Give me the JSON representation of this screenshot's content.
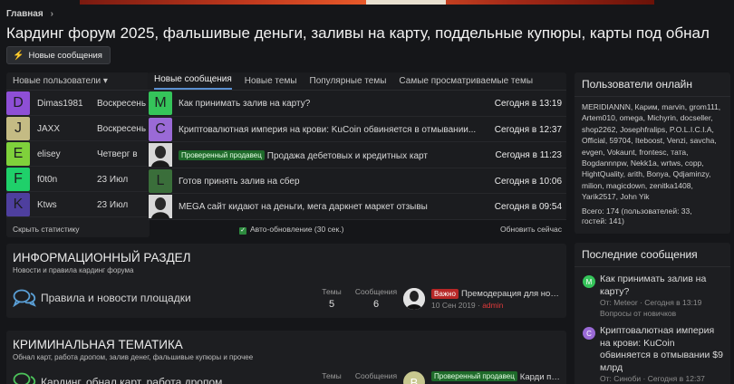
{
  "breadcrumb": {
    "home": "Главная",
    "sep": "›"
  },
  "page_title": "Кардинг форум 2025, фальшивые деньги, заливы на карту, поддельные купюры, карты под обнал",
  "new_posts_button": "Новые сообщения",
  "new_users": {
    "header": "Новые пользователи ▾",
    "rows": [
      {
        "letter": "D",
        "color": "#8e4fd6",
        "name": "Dimas1981",
        "date": "Воскресень"
      },
      {
        "letter": "J",
        "color": "#c4bb84",
        "name": "JAXX",
        "date": "Воскресень"
      },
      {
        "letter": "E",
        "color": "#7fd13b",
        "name": "elisey",
        "date": "Четверг в"
      },
      {
        "letter": "F",
        "color": "#1fd06a",
        "name": "f0t0n",
        "date": "23 Июл"
      },
      {
        "letter": "K",
        "color": "#4e3f9e",
        "name": "Ktws",
        "date": "23 Июл"
      }
    ]
  },
  "tabs": [
    "Новые сообщения",
    "Новые темы",
    "Популярные темы",
    "Самые просматриваемые темы"
  ],
  "messages": [
    {
      "letter": "M",
      "color": "#35c45a",
      "badge": "",
      "title": "Как принимать залив на карту?",
      "time": "Сегодня в 13:19"
    },
    {
      "letter": "C",
      "color": "#9a6ad6",
      "badge": "",
      "title": "Криптовалютная империя на крови: KuCoin обвиняется в отмывании...",
      "time": "Сегодня в 12:37"
    },
    {
      "letter": "",
      "color": "#dcdcdc",
      "badge": "Проверенный продавец",
      "title": "Продажа дебетовых и кредитных карт",
      "time": "Сегодня в 11:23"
    },
    {
      "letter": "L",
      "color": "#3a6e3a",
      "badge": "",
      "title": "Готов принять залив на сбер",
      "time": "Сегодня в 10:06"
    },
    {
      "letter": "",
      "color": "#cfcfcf",
      "badge": "",
      "title": "MEGA сайт кидают на деньги, мега даркнет маркет отзывы",
      "time": "Сегодня в 09:54"
    }
  ],
  "stats_bar": {
    "left": "Скрыть статистику",
    "middle": "Авто-обновление (30 сек.)",
    "right": "Обновить сейчас"
  },
  "online": {
    "title": "Пользователи онлайн",
    "list": "MERIDIANNN, Карим, marvin, grom111, Artem010, omega, Michyrin, docseller, shop2262, Josephfralips, P.O.L.I.C.I.A, Official, 59704, Iteboost, Venzi, savcha, evgen, Vokaunt, frontesc, тата, Bogdannnpw, Nekk1a, wrtws, copp, HightQuality, arith, Bonya, Qdjaminzy, milion, magicdown, zenitka1408, Yarik2517, John Yik",
    "total_line1": "Всего: 174 (пользователей: 33,",
    "total_line2": "гостей: 141)"
  },
  "recent": {
    "title": "Последние сообщения",
    "items": [
      {
        "letter": "M",
        "color": "#35c45a",
        "title": "Как принимать залив на карту?",
        "meta1": "От: Meteor · Сегодня в 13:19",
        "meta2": "Вопросы от новичков"
      },
      {
        "letter": "C",
        "color": "#9a6ad6",
        "title": "Криптовалютная империя на крови: KuCoin обвиняется в отмывании $9 млрд",
        "meta1": "От: Синоби · Сегодня в 12:37",
        "meta2": ""
      }
    ]
  },
  "sections": [
    {
      "title": "ИНФОРМАЦИОННЫЙ РАЗДЕЛ",
      "desc": "Новости и правила кардинг форума",
      "node": "Правила и новости площадки",
      "col_themes": "Темы",
      "themes": "5",
      "col_posts": "Сообщения",
      "posts": "6",
      "lp_badge": "Важно",
      "lp_title": "Премодерация для новы...",
      "lp_date": "10 Сен 2019 · ",
      "lp_user": "admin"
    },
    {
      "title": "КРИМИНАЛЬНАЯ ТЕМАТИКА",
      "desc": "Обнал карт, работа дропом, залив денег, фальшивые купюры и прочее",
      "node": "Кардинг, обнал карт, работа дропом",
      "col_themes": "Темы",
      "col_posts": "Сообщения",
      "lp_letter": "B",
      "lp_badge": "Проверенный продавец",
      "lp_title": "Карди пр..."
    }
  ]
}
